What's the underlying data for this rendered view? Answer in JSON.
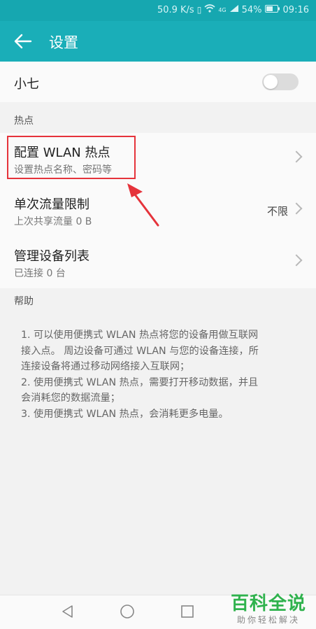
{
  "status_bar": {
    "speed": "50.9 K/s",
    "network": "4G",
    "battery": "54%",
    "time": "09:16"
  },
  "app_bar": {
    "title": "设置"
  },
  "hotspot_toggle": {
    "label": "小七",
    "enabled": false
  },
  "sections": {
    "hotspot_header": "热点",
    "help_header": "帮助"
  },
  "items": [
    {
      "title": "配置 WLAN 热点",
      "subtitle": "设置热点名称、密码等",
      "value": ""
    },
    {
      "title": "单次流量限制",
      "subtitle": "上次共享流量 0 B",
      "value": "不限"
    },
    {
      "title": "管理设备列表",
      "subtitle": "已连接 0 台",
      "value": ""
    }
  ],
  "help": {
    "line1": "1. 可以使用便携式 WLAN 热点将您的设备用做互联网",
    "line2": "接入点。 周边设备可通过 WLAN 与您的设备连接，所",
    "line3": "连接设备将通过移动网络接入互联网；",
    "line4": "2. 使用便携式 WLAN 热点，需要打开移动数据，并且",
    "line5": "会消耗您的数据流量；",
    "line6": "3. 使用便携式 WLAN 热点，会消耗更多电量。"
  },
  "watermark": {
    "main": "百科全说",
    "sub": "助你轻松解决"
  },
  "colors": {
    "app_bar": "#1aaeb8",
    "highlight": "#e5333b",
    "watermark": "#2fb24d"
  }
}
